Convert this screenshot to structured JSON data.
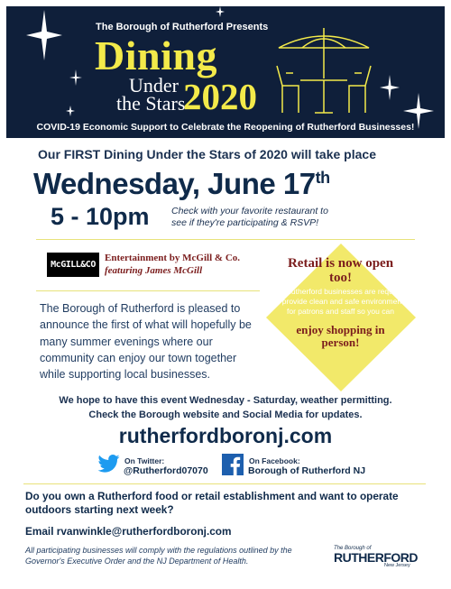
{
  "banner": {
    "presents": "The Borough of Rutherford Presents",
    "dining": "Dining",
    "under": "Under",
    "the_stars": "the Stars",
    "year": "2020",
    "subtitle": "COVID-19 Economic Support to Celebrate the Reopening of Rutherford Businesses!",
    "background_color": "#0f1f3a",
    "accent_color": "#f3ea4a",
    "icons": [
      "sparkle-star-icon",
      "patio-umbrella-table-icon"
    ]
  },
  "event": {
    "intro": "Our FIRST Dining Under the Stars of 2020 will take place",
    "date": "Wednesday, June 17",
    "date_suffix": "th",
    "time": "5 - 10pm",
    "check_line1": "Check with your favorite restaurant to",
    "check_line2": "see if they're participating & RSVP!"
  },
  "entertainment": {
    "logo_text": "McGILL&CO",
    "line1": "Entertainment by McGill & Co.",
    "line2": "featuring James McGill"
  },
  "retail": {
    "heading": "Retail is now open too!",
    "body": "All Rutherford businesses are required to provide clean and safe environments for patrons and staff so you can",
    "emphasis": "enjoy shopping in person!",
    "diamond_color": "#f2e96a",
    "heading_color": "#7b1d1d"
  },
  "intro_paragraph": "The Borough of Rutherford is pleased to announce the first of what will hopefully be many summer evenings where our community can enjoy our town together while supporting local businesses.",
  "notice": {
    "line1": "We hope to have this event Wednesday - Saturday, weather permitting.",
    "line2": "Check the Borough website and Social Media for updates."
  },
  "website": "rutherfordboronj.com",
  "social": {
    "twitter_label": "On Twitter:",
    "twitter_handle": "@Rutherford07070",
    "facebook_label": "On Facebook:",
    "facebook_handle": "Borough of Rutherford NJ"
  },
  "footer": {
    "question": "Do you own a Rutherford food or retail establishment and want to operate outdoors starting next week?",
    "email": "Email rvanwinkle@rutherfordboronj.com",
    "compliance": "All participating businesses will comply with the regulations outlined by the Governor's Executive Order and the NJ Department of Health.",
    "logo_top": "The Borough of",
    "logo_name": "RUTHERFORD",
    "logo_bottom": "New Jersey"
  }
}
